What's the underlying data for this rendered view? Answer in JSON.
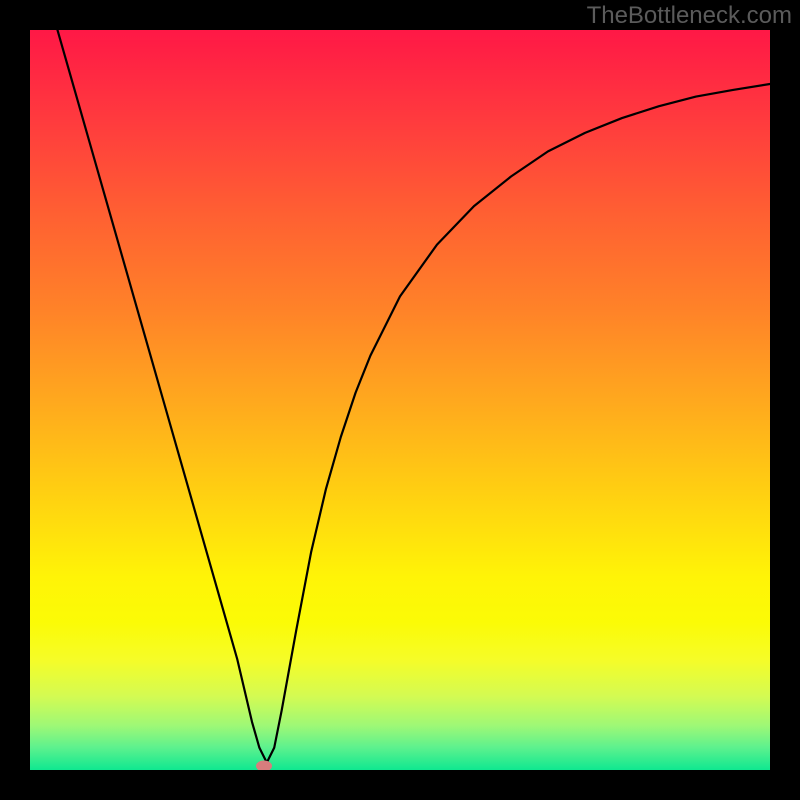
{
  "watermark": "TheBottleneck.com",
  "chart_data": {
    "type": "line",
    "title": "",
    "xlabel": "",
    "ylabel": "",
    "xlim": [
      0,
      100
    ],
    "ylim": [
      0,
      100
    ],
    "grid": false,
    "series": [
      {
        "name": "bottleneck-curve",
        "x": [
          0,
          2,
          4,
          6,
          8,
          10,
          12,
          14,
          16,
          18,
          20,
          22,
          24,
          26,
          28,
          30,
          31,
          32,
          33,
          34,
          36,
          38,
          40,
          42,
          44,
          46,
          50,
          55,
          60,
          65,
          70,
          75,
          80,
          85,
          90,
          95,
          100
        ],
        "y": [
          113,
          106,
          99,
          92,
          85,
          78,
          71,
          64,
          57,
          50,
          43,
          36,
          29,
          22,
          15,
          6.5,
          3,
          1,
          3,
          8,
          19,
          29.5,
          38,
          45,
          51,
          56,
          64,
          71,
          76.2,
          80.2,
          83.6,
          86.1,
          88.1,
          89.7,
          91,
          91.9,
          92.7
        ]
      }
    ],
    "marker": {
      "x": 31.6,
      "y": 0.5,
      "color": "#d87d7d"
    },
    "gradient_stops": [
      {
        "offset": 0,
        "color": "#ff1846"
      },
      {
        "offset": 12,
        "color": "#ff3a3e"
      },
      {
        "offset": 25,
        "color": "#ff6032"
      },
      {
        "offset": 38,
        "color": "#ff8328"
      },
      {
        "offset": 50,
        "color": "#ffa81e"
      },
      {
        "offset": 62,
        "color": "#ffce12"
      },
      {
        "offset": 74,
        "color": "#fff407"
      },
      {
        "offset": 80,
        "color": "#fbfb06"
      },
      {
        "offset": 85,
        "color": "#f6fc27"
      },
      {
        "offset": 90,
        "color": "#d4fb52"
      },
      {
        "offset": 94,
        "color": "#9ef876"
      },
      {
        "offset": 97,
        "color": "#5cf18e"
      },
      {
        "offset": 100,
        "color": "#0fe890"
      }
    ]
  }
}
